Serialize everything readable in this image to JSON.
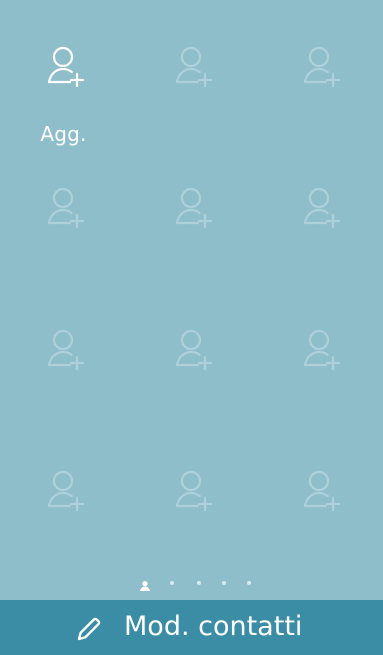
{
  "grid": {
    "add_label": "Agg.",
    "add_icon": "person-add-icon",
    "placeholder_icon": "person-add-icon"
  },
  "page_indicator": {
    "pages": 5,
    "current": 1,
    "first_icon": "person-icon"
  },
  "bottom_bar": {
    "label": "Mod. contatti",
    "icon": "pencil-icon"
  },
  "colors": {
    "background": "#8fbecb",
    "bottom_bar": "#3b8da6",
    "foreground": "#ffffff"
  }
}
